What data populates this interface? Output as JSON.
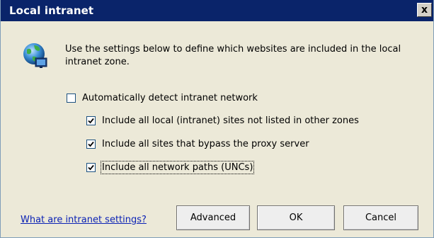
{
  "dialog": {
    "title": "Local intranet",
    "close_label": "x"
  },
  "icon": {
    "name": "globe-network-icon"
  },
  "description": "Use the settings below to define which websites are included in the local intranet zone.",
  "checkboxes": [
    {
      "label": "Automatically detect intranet network",
      "checked": false
    },
    {
      "label": "Include all local (intranet) sites not listed in other zones",
      "checked": true
    },
    {
      "label": "Include all sites that bypass the proxy server",
      "checked": true
    },
    {
      "label": "Include all network paths (UNCs)",
      "checked": true
    }
  ],
  "footer": {
    "help_link": "What are intranet settings?",
    "advanced_label": "Advanced",
    "ok_label": "OK",
    "cancel_label": "Cancel"
  },
  "colors": {
    "titlebar": "#0a246a",
    "link": "#0b22b5",
    "dialog_bg": "#ece9d8"
  }
}
